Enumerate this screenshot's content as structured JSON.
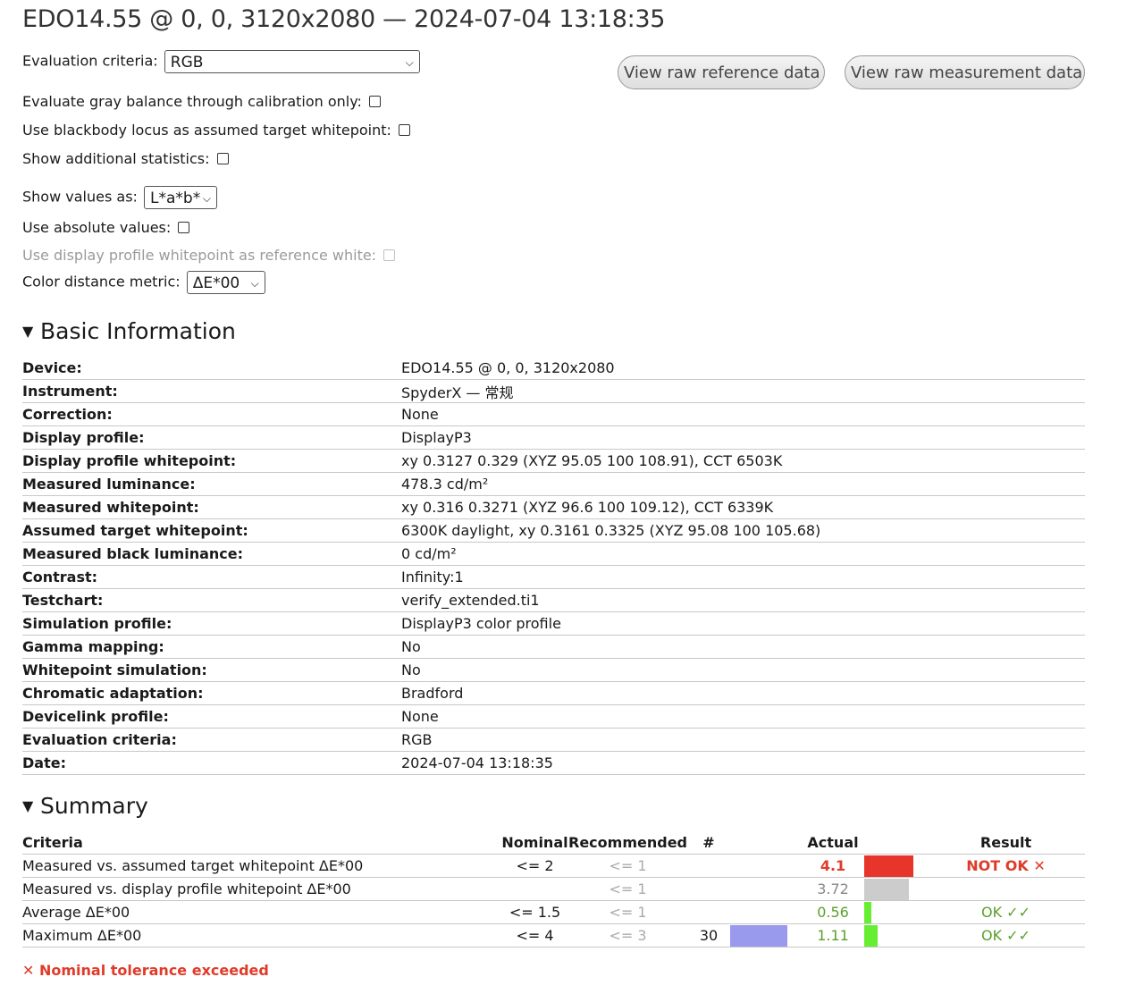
{
  "title": "EDO14.55 @ 0, 0, 3120x2080 — 2024-07-04 13:18:35",
  "controls": {
    "evaluation_criteria_label": "Evaluation criteria:",
    "evaluation_criteria_value": "RGB",
    "gray_balance_label": "Evaluate gray balance through calibration only:",
    "blackbody_label": "Use blackbody locus as assumed target whitepoint:",
    "additional_stats_label": "Show additional statistics:",
    "show_values_label": "Show values as:",
    "show_values_value": "L*a*b*",
    "absolute_label": "Use absolute values:",
    "profile_whitepoint_label": "Use display profile whitepoint as reference white:",
    "metric_label": "Color distance metric:",
    "metric_value": "ΔE*00"
  },
  "buttons": {
    "raw_reference": "View raw reference data",
    "raw_measurement": "View raw measurement data"
  },
  "basic_info": {
    "heading": "Basic Information",
    "rows": [
      {
        "k": "Device:",
        "v": "EDO14.55 @ 0, 0, 3120x2080"
      },
      {
        "k": "Instrument:",
        "v": "SpyderX — 常规"
      },
      {
        "k": "Correction:",
        "v": "None"
      },
      {
        "k": "Display profile:",
        "v": "DisplayP3"
      },
      {
        "k": "Display profile whitepoint:",
        "v": "xy 0.3127 0.329 (XYZ 95.05 100 108.91), CCT 6503K"
      },
      {
        "k": "Measured luminance:",
        "v": "478.3 cd/m²"
      },
      {
        "k": "Measured whitepoint:",
        "v": "xy 0.316 0.3271 (XYZ 96.6 100 109.12), CCT 6339K"
      },
      {
        "k": "Assumed target whitepoint:",
        "v": "6300K daylight, xy 0.3161 0.3325 (XYZ 95.08 100 105.68)"
      },
      {
        "k": "Measured black luminance:",
        "v": "0 cd/m²"
      },
      {
        "k": "Contrast:",
        "v": "Infinity:1"
      },
      {
        "k": "Testchart:",
        "v": "verify_extended.ti1"
      },
      {
        "k": "Simulation profile:",
        "v": "DisplayP3 color profile"
      },
      {
        "k": "Gamma mapping:",
        "v": "No"
      },
      {
        "k": "Whitepoint simulation:",
        "v": "No"
      },
      {
        "k": "Chromatic adaptation:",
        "v": "Bradford"
      },
      {
        "k": "Devicelink profile:",
        "v": "None"
      },
      {
        "k": "Evaluation criteria:",
        "v": "RGB"
      },
      {
        "k": "Date:",
        "v": "2024-07-04 13:18:35"
      }
    ]
  },
  "summary": {
    "heading": "Summary",
    "headers": {
      "criteria": "Criteria",
      "nominal": "Nominal",
      "recommended": "Recommended",
      "num": "#",
      "actual": "Actual",
      "result": "Result"
    },
    "rows": [
      {
        "criteria": "Measured vs. assumed target whitepoint ΔE*00",
        "nominal": "<= 2",
        "recommended": "<= 1",
        "num": "",
        "actual": "4.1",
        "actual_color": "#e03b2a",
        "actual_bold": true,
        "bar_pct": 0.55,
        "bar_color": "#e8352b",
        "result": "NOT OK ✕",
        "result_color": "#e03b2a",
        "result_bold": true
      },
      {
        "criteria": "Measured vs. display profile whitepoint ΔE*00",
        "nominal": "",
        "recommended": "<= 1",
        "num": "",
        "actual": "3.72",
        "actual_color": "#888888",
        "actual_bold": false,
        "bar_pct": 0.5,
        "bar_color": "#cccccc",
        "result": "",
        "result_color": "#888888",
        "result_bold": false
      },
      {
        "criteria": "Average ΔE*00",
        "nominal": "<= 1.5",
        "recommended": "<= 1",
        "num": "",
        "actual": "0.56",
        "actual_color": "#5aa02c",
        "actual_bold": false,
        "bar_pct": 0.08,
        "bar_color": "#66ee33",
        "result": "OK ✓✓",
        "result_color": "#5aa02c",
        "result_bold": false
      },
      {
        "criteria": "Maximum ΔE*00",
        "nominal": "<= 4",
        "recommended": "<= 3",
        "num": "30",
        "num_bar_color": "#9999ee",
        "actual": "1.11",
        "actual_color": "#5aa02c",
        "actual_bold": false,
        "bar_pct": 0.15,
        "bar_color": "#66ee33",
        "result": "OK ✓✓",
        "result_color": "#5aa02c",
        "result_bold": false
      }
    ]
  },
  "footer_note": "✕ Nominal tolerance exceeded"
}
